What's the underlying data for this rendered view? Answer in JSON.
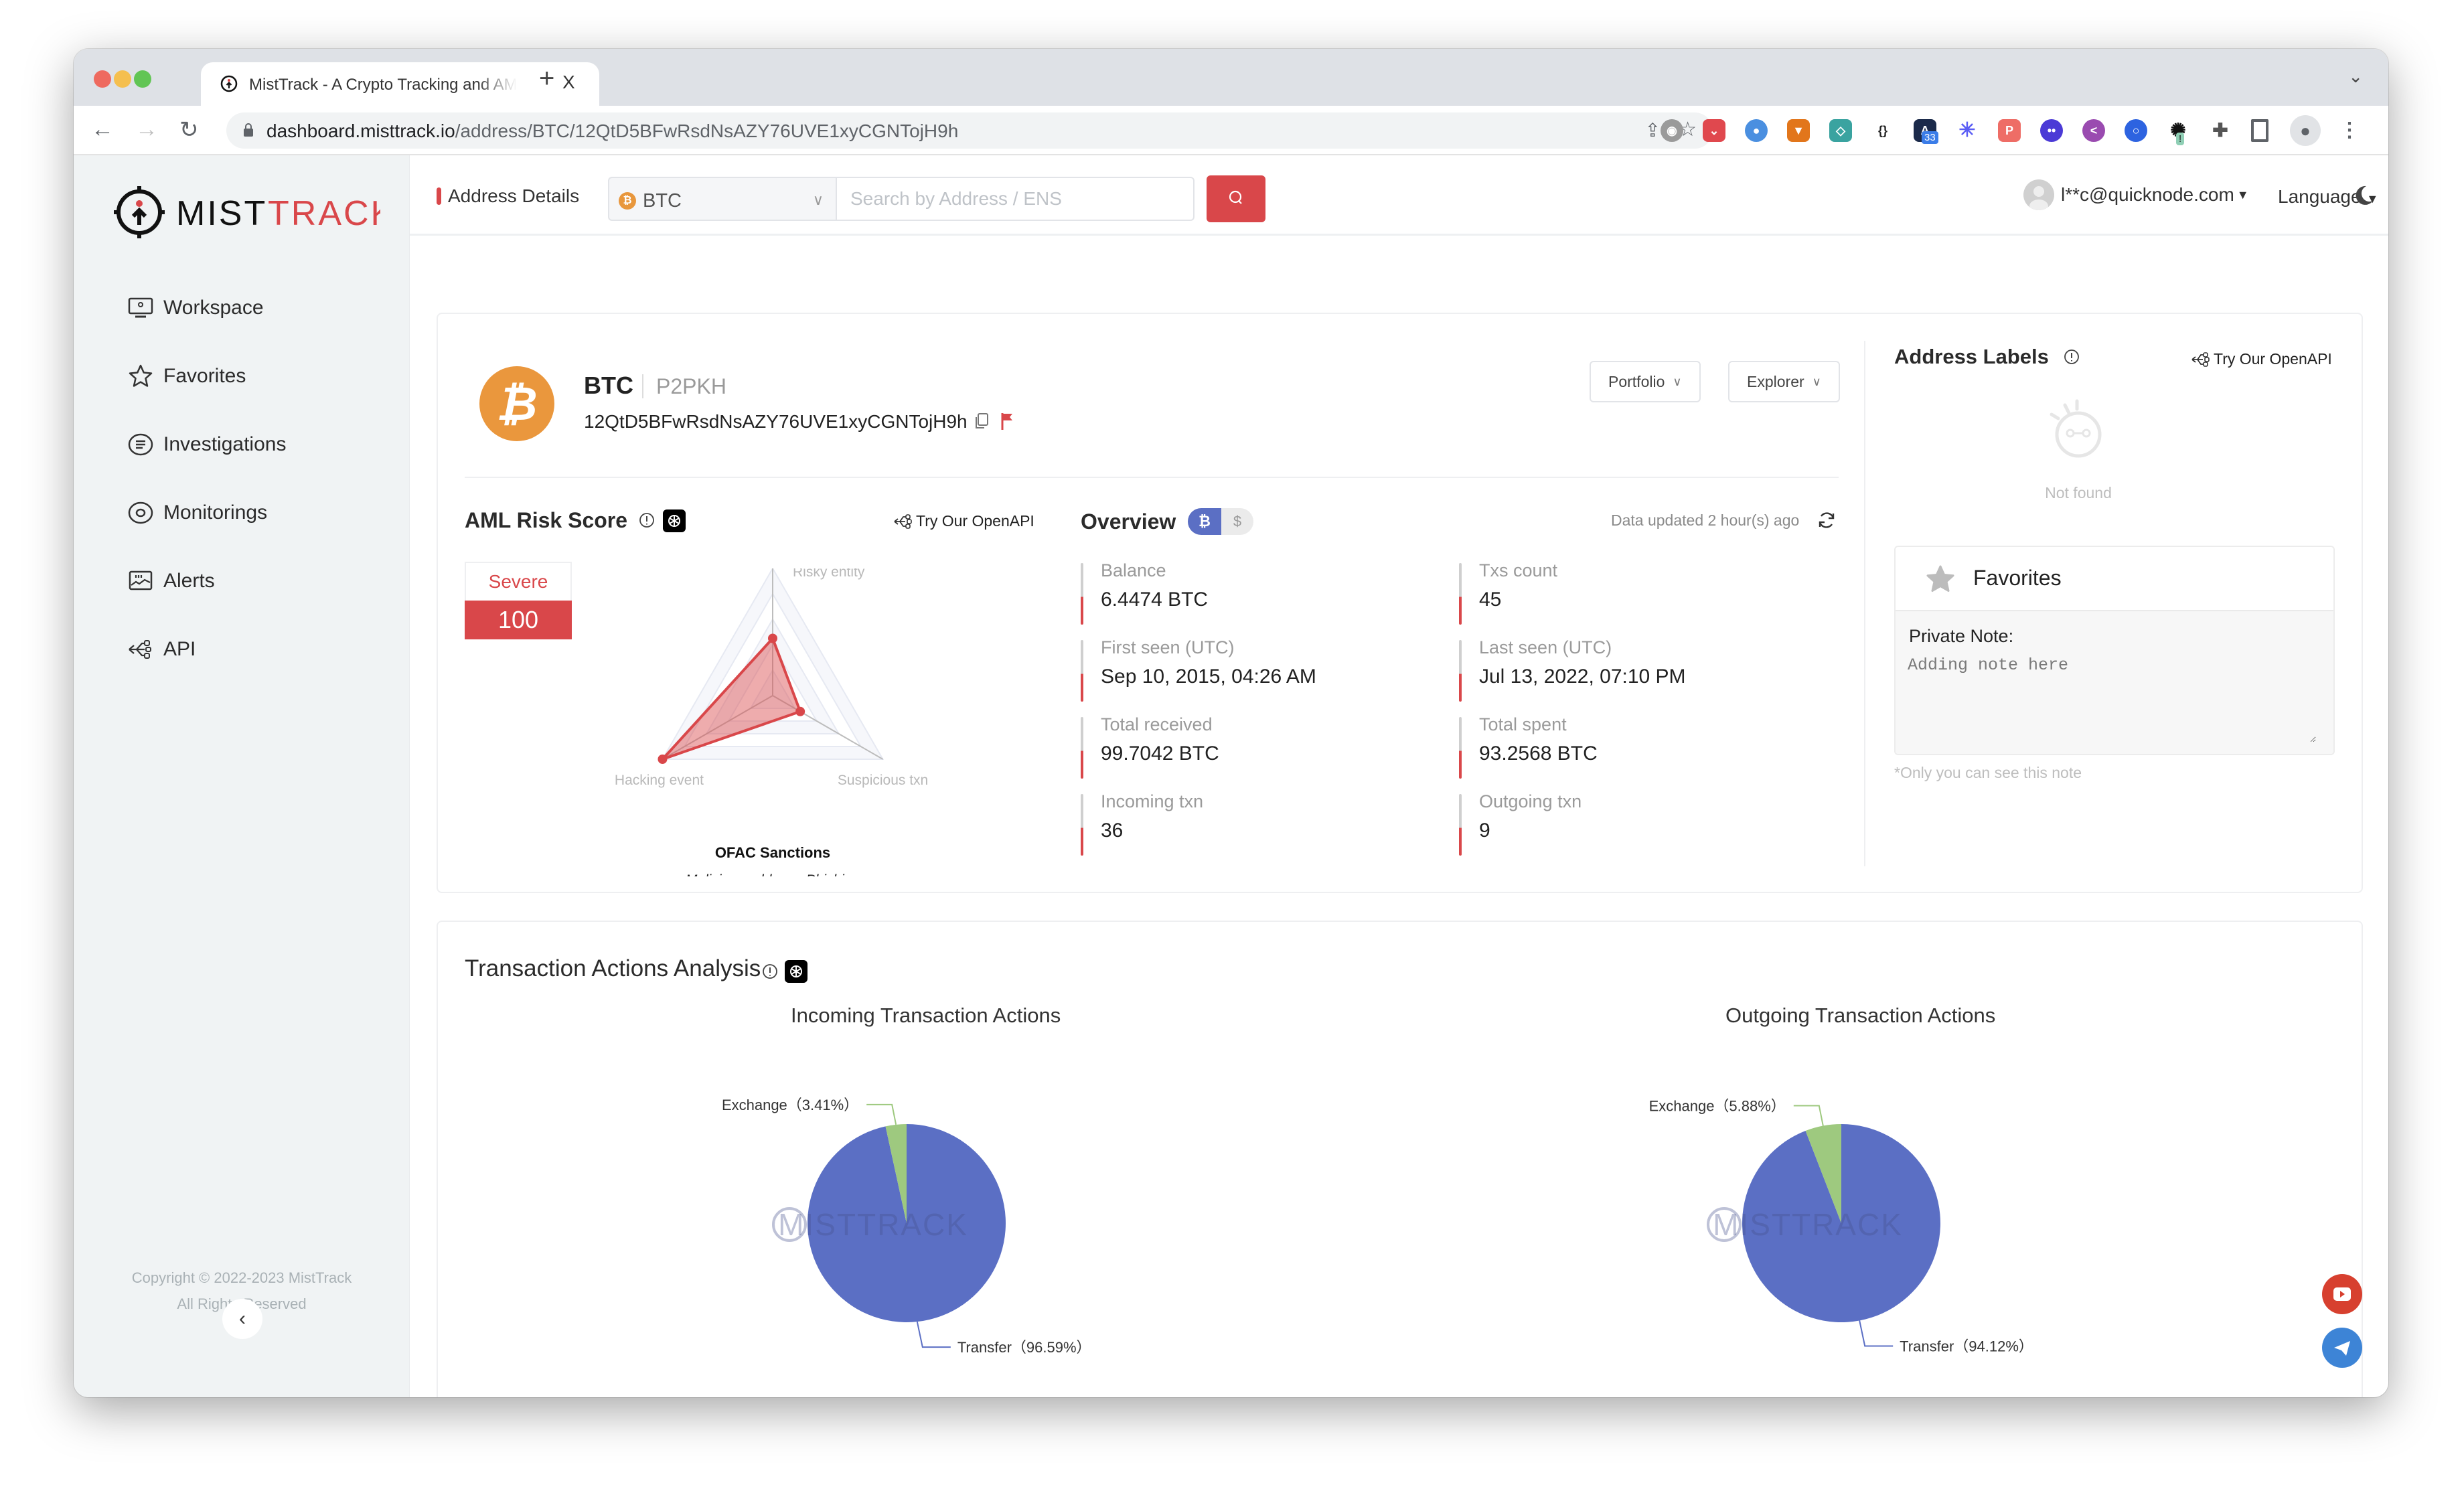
{
  "browser": {
    "tab_title": "MistTrack - A Crypto Tracking and AML Platform",
    "tab_close": "X",
    "new_tab": "+",
    "url_host": "dashboard.misttrack.io",
    "url_path": "/address/BTC/12QtD5BFwRsdNsAZY76UVE1xyCGNTojH9h",
    "extension_badge": "33",
    "extension_alert": "!"
  },
  "sidebar": {
    "logo_left": "MIST",
    "logo_right": "TRACK",
    "items": [
      {
        "label": "Workspace",
        "icon": "monitor-icon"
      },
      {
        "label": "Favorites",
        "icon": "star-icon"
      },
      {
        "label": "Investigations",
        "icon": "list-target-icon"
      },
      {
        "label": "Monitorings",
        "icon": "eye-target-icon"
      },
      {
        "label": "Alerts",
        "icon": "alert-chart-icon"
      },
      {
        "label": "API",
        "icon": "api-icon"
      }
    ],
    "copyright_line1": "Copyright © 2022-2023 MistTrack",
    "copyright_line2": "All Rights Reserved",
    "collapse_glyph": "‹"
  },
  "header": {
    "page_title": "Address Details",
    "chain_select": "BTC",
    "search_placeholder": "Search by Address / ENS",
    "user_email": "l**c@quicknode.com",
    "language": "Language"
  },
  "address": {
    "coin": "BTC",
    "type": "P2PKH",
    "address": "12QtD5BFwRsdNsAZY76UVE1xyCGNTojH9h",
    "portfolio_button": "Portfolio",
    "explorer_button": "Explorer"
  },
  "aml": {
    "title": "AML Risk Score",
    "openapi_link": "Try Our OpenAPI",
    "risk_level": "Severe",
    "risk_score": "100",
    "risk_tag": "OFAC Sanctions",
    "risk_detail": "Malicious address, Phishing"
  },
  "overview": {
    "title": "Overview",
    "unit_btc": "₿",
    "unit_usd": "$",
    "updated": "Data updated 2 hour(s) ago",
    "stats": [
      {
        "label": "Balance",
        "value": "6.4474 BTC"
      },
      {
        "label": "Txs count",
        "value": "45"
      },
      {
        "label": "First seen (UTC)",
        "value": "Sep 10, 2015, 04:26 AM"
      },
      {
        "label": "Last seen (UTC)",
        "value": "Jul 13, 2022, 07:10 PM"
      },
      {
        "label": "Total received",
        "value": "99.7042 BTC"
      },
      {
        "label": "Total spent",
        "value": "93.2568 BTC"
      },
      {
        "label": "Incoming txn",
        "value": "36"
      },
      {
        "label": "Outgoing txn",
        "value": "9"
      }
    ]
  },
  "labels": {
    "title": "Address Labels",
    "openapi_link": "Try Our OpenAPI",
    "empty_text": "Not found",
    "favorites_title": "Favorites",
    "private_note_label": "Private Note:",
    "note_placeholder": "Adding note here",
    "note_hint": "*Only you can see this note"
  },
  "analysis": {
    "title": "Transaction Actions Analysis"
  },
  "colors": {
    "accent": "#d9474a",
    "btc": "#ea973d",
    "transfer": "#5b6fc4",
    "exchange": "#9ec97f"
  },
  "chart_data": [
    {
      "type": "radar",
      "title": "AML Risk Score",
      "axes": [
        "Risky entity",
        "Suspicious txn",
        "Hacking event"
      ],
      "values": [
        0.45,
        0.25,
        1.0
      ],
      "range": [
        0,
        1
      ],
      "grid": true
    },
    {
      "type": "pie",
      "title": "Incoming Transaction Actions",
      "categories": [
        "Transfer",
        "Exchange"
      ],
      "values": [
        96.59,
        3.41
      ],
      "labels": [
        "Transfer（96.59%）",
        "Exchange（3.41%）"
      ],
      "legend": "bottom"
    },
    {
      "type": "pie",
      "title": "Outgoing Transaction Actions",
      "categories": [
        "Transfer",
        "Exchange"
      ],
      "values": [
        94.12,
        5.88
      ],
      "labels": [
        "Transfer（94.12%）",
        "Exchange（5.88%）"
      ],
      "legend": "bottom"
    }
  ]
}
